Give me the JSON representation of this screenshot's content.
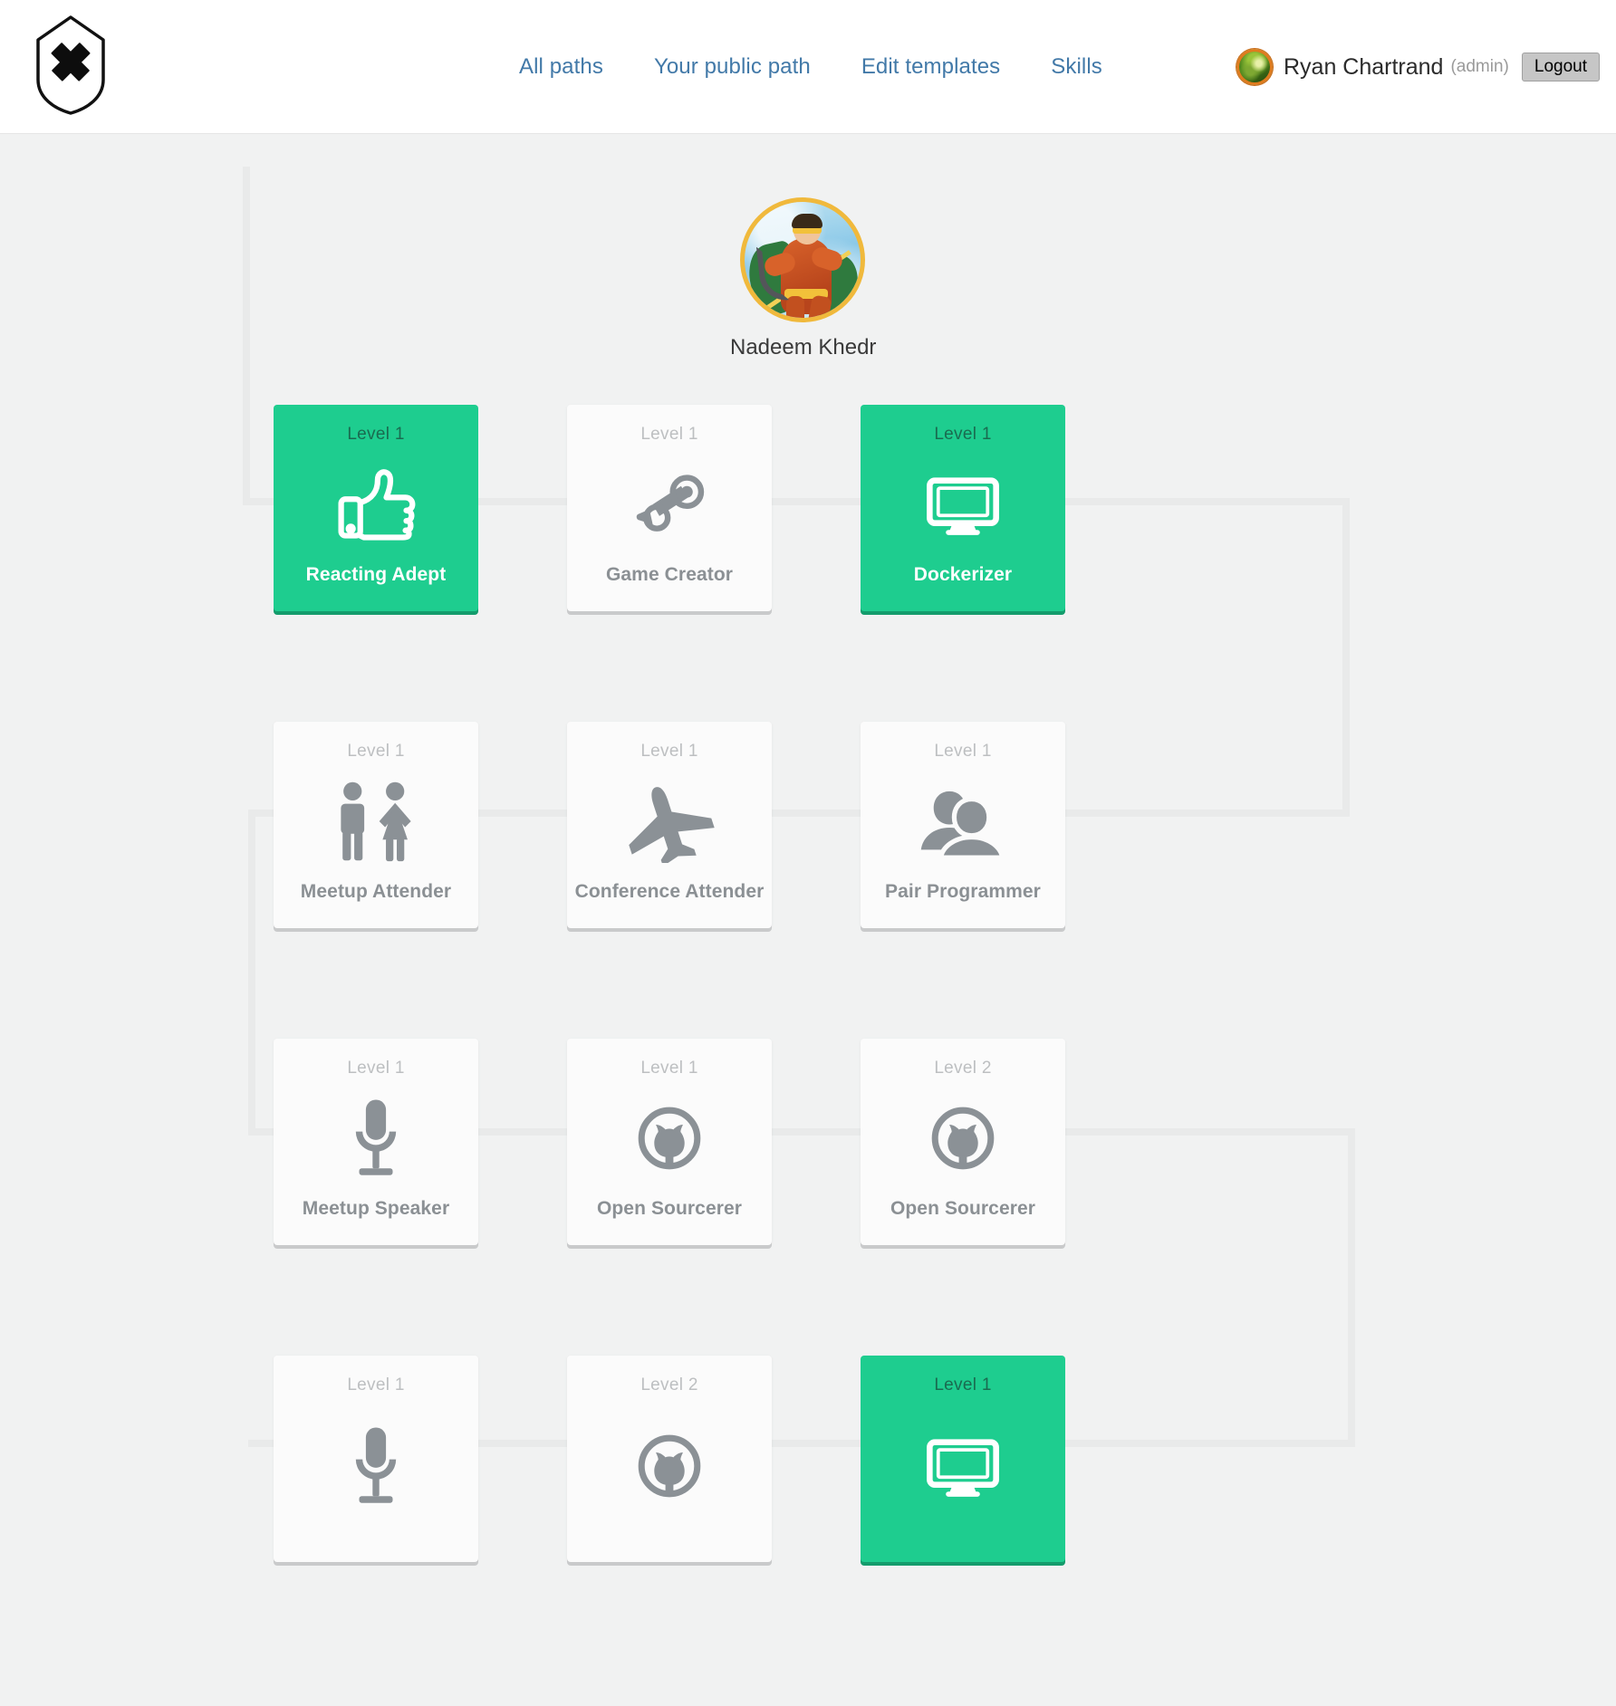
{
  "header": {
    "logo_name": "shield-x-logo",
    "nav": [
      {
        "label": "All paths",
        "name": "nav-all-paths"
      },
      {
        "label": "Your public path",
        "name": "nav-your-public-path"
      },
      {
        "label": "Edit templates",
        "name": "nav-edit-templates"
      },
      {
        "label": "Skills",
        "name": "nav-skills"
      }
    ],
    "user": {
      "name": "Ryan Chartrand",
      "role": "(admin)",
      "logout_label": "Logout"
    },
    "colors": {
      "nav_link": "#4279a8",
      "logout_bg": "#c6c6c6"
    }
  },
  "root": {
    "label": "Nadeem Khedr"
  },
  "theme": {
    "background": "#f1f2f2",
    "earned_green": "#1ecd8f",
    "earned_green_shadow": "#149c6c",
    "card_unearned": "#fbfbfb",
    "connector": "#e9eaea",
    "icon_gray": "#8b9196"
  },
  "cards": [
    {
      "level": "Level 1",
      "title": "Reacting Adept",
      "icon": "thumbs-up-icon",
      "earned": true,
      "col": 0,
      "row": 0
    },
    {
      "level": "Level 1",
      "title": "Game Creator",
      "icon": "steam-icon",
      "earned": false,
      "col": 1,
      "row": 0
    },
    {
      "level": "Level 1",
      "title": "Dockerizer",
      "icon": "desktop-monitor-icon",
      "earned": true,
      "col": 2,
      "row": 0
    },
    {
      "level": "Level 1",
      "title": "Meetup Attender",
      "icon": "man-woman-icon",
      "earned": false,
      "col": 0,
      "row": 1
    },
    {
      "level": "Level 1",
      "title": "Conference Attender",
      "icon": "airplane-icon",
      "earned": false,
      "col": 1,
      "row": 1
    },
    {
      "level": "Level 1",
      "title": "Pair Programmer",
      "icon": "two-users-icon",
      "earned": false,
      "col": 2,
      "row": 1
    },
    {
      "level": "Level 1",
      "title": "Meetup Speaker",
      "icon": "microphone-icon",
      "earned": false,
      "col": 0,
      "row": 2
    },
    {
      "level": "Level 1",
      "title": "Open Sourcerer",
      "icon": "github-circle-icon",
      "earned": false,
      "col": 1,
      "row": 2
    },
    {
      "level": "Level 2",
      "title": "Open Sourcerer",
      "icon": "github-circle-icon",
      "earned": false,
      "col": 2,
      "row": 2
    },
    {
      "level": "Level 1",
      "title": "",
      "icon": "microphone-icon",
      "earned": false,
      "col": 0,
      "row": 3
    },
    {
      "level": "Level 2",
      "title": "",
      "icon": "github-circle-icon",
      "earned": false,
      "col": 1,
      "row": 3
    },
    {
      "level": "Level 1",
      "title": "",
      "icon": "desktop-monitor-icon",
      "earned": true,
      "col": 2,
      "row": 3
    }
  ]
}
